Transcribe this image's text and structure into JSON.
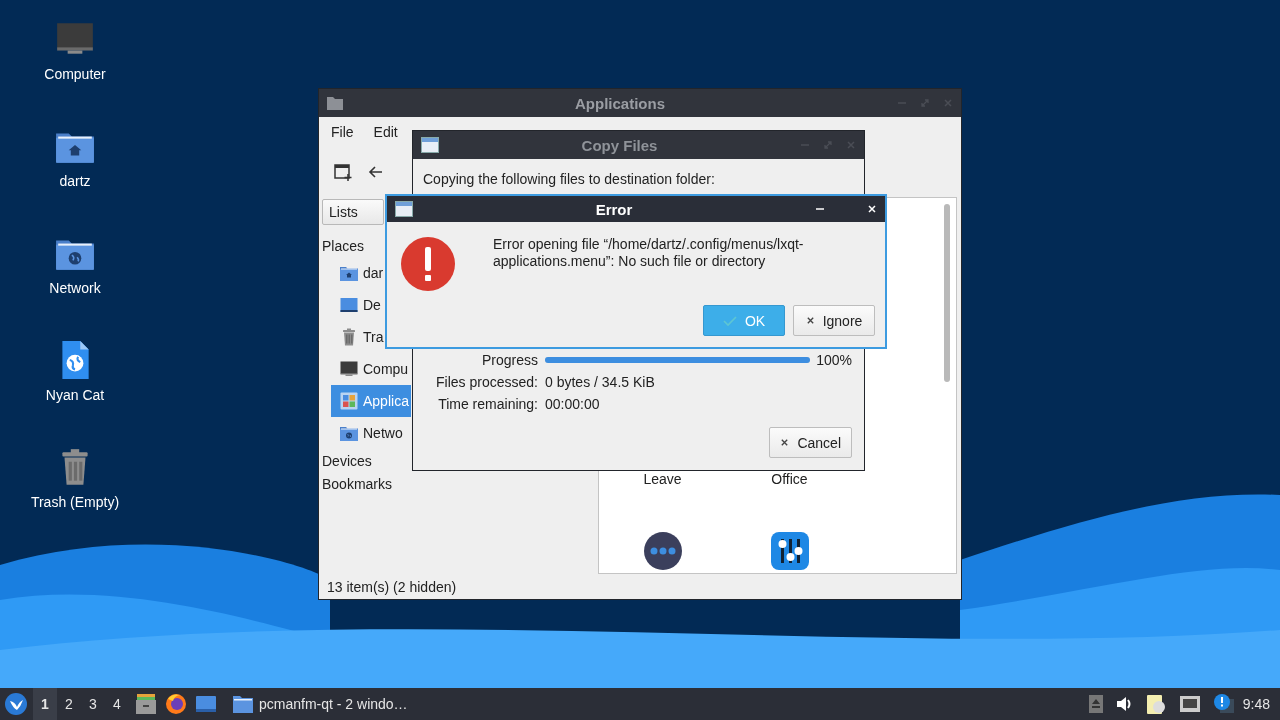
{
  "desktop_icons": [
    {
      "label": "Computer",
      "kind": "computer"
    },
    {
      "label": "dartz",
      "kind": "home"
    },
    {
      "label": "Network",
      "kind": "network"
    },
    {
      "label": "Nyan Cat",
      "kind": "webfile"
    },
    {
      "label": "Trash (Empty)",
      "kind": "trash"
    }
  ],
  "file_manager": {
    "title": "Applications",
    "menu": [
      "File",
      "Edit"
    ],
    "view_selector": "Lists",
    "sidebar": [
      {
        "label": "Places",
        "items": [
          {
            "label": "dar",
            "kind": "home",
            "selected": false
          },
          {
            "label": "De",
            "kind": "desktop",
            "selected": false
          },
          {
            "label": "Tra",
            "kind": "trash",
            "selected": false
          },
          {
            "label": "Compu",
            "kind": "computer",
            "selected": false
          },
          {
            "label": "Applica",
            "kind": "apps",
            "selected": true
          },
          {
            "label": "Netwo",
            "kind": "network",
            "selected": false
          }
        ]
      },
      {
        "label": "Devices"
      },
      {
        "label": "Bookmarks"
      }
    ],
    "files": [
      {
        "label": "Leave"
      },
      {
        "label": "Office"
      }
    ],
    "next_row": [
      {
        "kind": "dots"
      },
      {
        "kind": "sliders"
      }
    ],
    "status": "13 item(s) (2 hidden)"
  },
  "copy_dialog": {
    "title": "Copy Files",
    "message": "Copying the following files to destination folder:",
    "progress": {
      "label": "Progress",
      "level": 1.0,
      "reading": "100%"
    },
    "details": [
      {
        "label": "Files processed:",
        "value": "0 bytes / 34.5 KiB"
      },
      {
        "label": "Time remaining:",
        "value": "00:00:00"
      }
    ],
    "buttons": [
      {
        "label": "Cancel",
        "kind": "cancel"
      }
    ]
  },
  "error_dialog": {
    "title": "Error",
    "message": "Error opening file “/home/dartz/.config/menus/lxqt-applications.menu”: No such file or directory",
    "buttons": [
      {
        "label": "OK",
        "kind": "ok",
        "default": true
      },
      {
        "label": "Ignore",
        "kind": "ignore",
        "default": false
      }
    ]
  },
  "taskbar": {
    "desktops": [
      {
        "label": "1",
        "selected": true
      },
      {
        "label": "2",
        "selected": false
      },
      {
        "label": "3",
        "selected": false
      },
      {
        "label": "4",
        "selected": false
      }
    ],
    "tasks": [
      {
        "label": "pcmanfm-qt - 2 windo…"
      }
    ],
    "clock": "9:48"
  }
}
